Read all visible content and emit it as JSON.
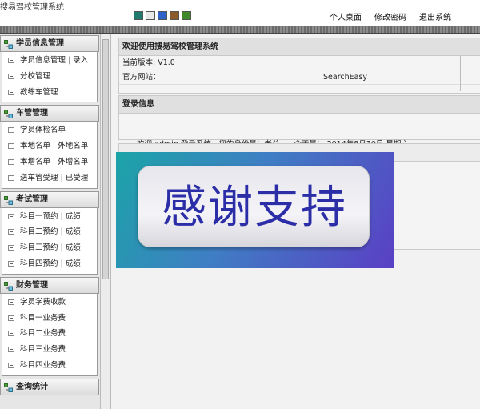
{
  "app": {
    "title": "搜易驾校管理系统"
  },
  "skins": [
    "#1f7a70",
    "#e8e8e8",
    "#2f62c8",
    "#8b5a2b",
    "#3f8a2a"
  ],
  "topnav": [
    "个人桌面",
    "修改密码",
    "退出系统"
  ],
  "sidebar": {
    "groups": [
      {
        "title": "学员信息管理",
        "items": [
          {
            "label": "学员信息管理",
            "extra": "录入"
          },
          {
            "label": "分校管理"
          },
          {
            "label": "教练车管理"
          }
        ]
      },
      {
        "title": "车管管理",
        "items": [
          {
            "label": "学员体检名单"
          },
          {
            "label": "本地名单",
            "extra": "外地名单"
          },
          {
            "label": "本增名单",
            "extra": "外增名单"
          },
          {
            "label": "送车管受理",
            "extra": "已受理"
          }
        ]
      },
      {
        "title": "考试管理",
        "items": [
          {
            "label": "科目一预约",
            "extra": "成绩"
          },
          {
            "label": "科目二预约",
            "extra": "成绩"
          },
          {
            "label": "科目三预约",
            "extra": "成绩"
          },
          {
            "label": "科目四预约",
            "extra": "成绩"
          }
        ]
      },
      {
        "title": "财务管理",
        "items": [
          {
            "label": "学员学费收款"
          },
          {
            "label": "科目一业务费"
          },
          {
            "label": "科目二业务费"
          },
          {
            "label": "科目三业务费"
          },
          {
            "label": "科目四业务费"
          }
        ]
      },
      {
        "title": "查询统计",
        "items": []
      }
    ]
  },
  "main": {
    "welcome": {
      "title": "欢迎使用搜易驾校管理系统",
      "version": "当前版本: V1.0",
      "website_label": "官方网站：",
      "website_value": "SearchEasy"
    },
    "login": {
      "title": "登录信息",
      "text": "欢迎 admin 登录系统，您的身份是：老总      今天是： 2014年8月30日 星期六"
    },
    "banner": {
      "text": "感谢支持"
    }
  }
}
